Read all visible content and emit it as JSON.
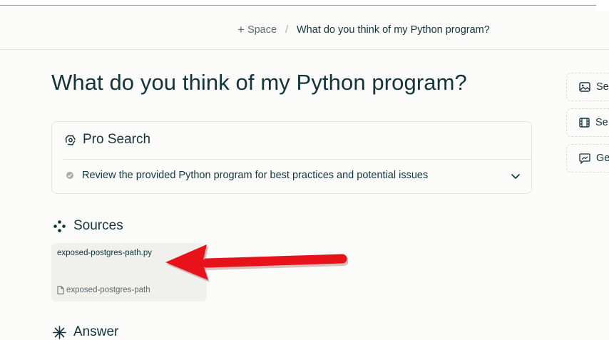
{
  "breadcrumb": {
    "space_label": "Space",
    "separator": "/",
    "current": "What do you think of my Python program?"
  },
  "thread": {
    "title": "What do you think of my Python program?"
  },
  "pro_search": {
    "title": "Pro Search",
    "step": "Review the provided Python program for best practices and potential issues"
  },
  "sources": {
    "title": "Sources",
    "items": [
      {
        "name": "exposed-postgres-path.py",
        "domain": "exposed-postgres-path"
      }
    ]
  },
  "answer": {
    "title": "Answer"
  },
  "sidebar": {
    "buttons": [
      {
        "label": "Se",
        "icon": "image-icon"
      },
      {
        "label": "Se",
        "icon": "film-icon"
      },
      {
        "label": "Ge",
        "icon": "image-sparkle-icon"
      }
    ]
  },
  "colors": {
    "background": "#fbfbf9",
    "text": "#13343b",
    "muted": "#5c6a6d",
    "annotation_arrow": "#e8121b"
  }
}
